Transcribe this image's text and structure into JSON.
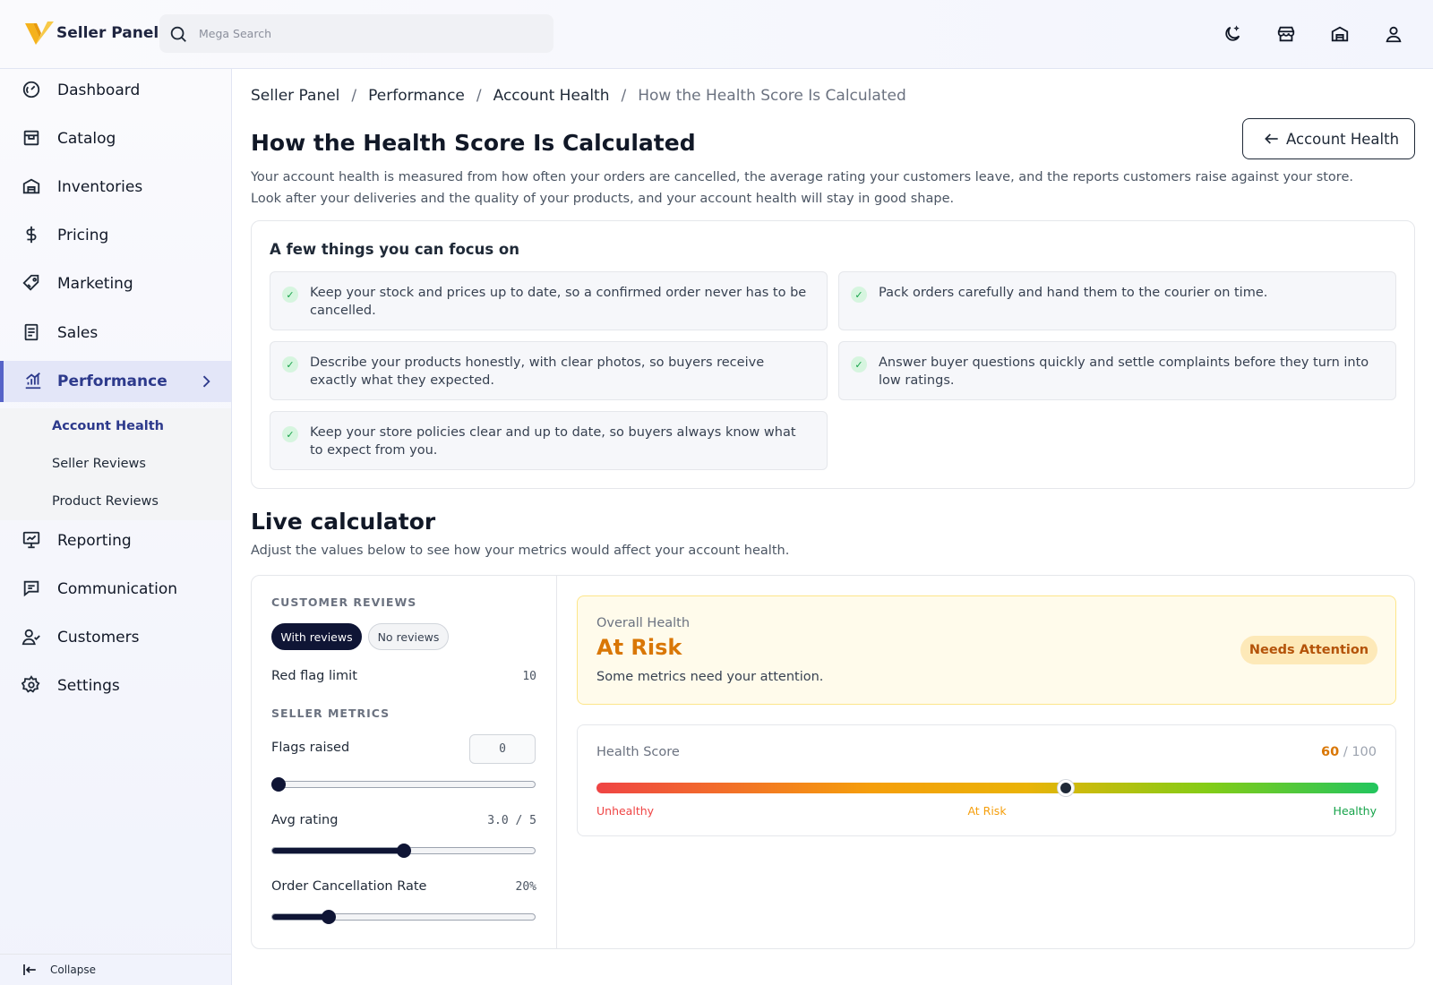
{
  "header": {
    "brand": "Seller Panel",
    "search_placeholder": "Mega Search",
    "icons": [
      "moon-icon",
      "store-icon",
      "warehouse-icon",
      "user-icon"
    ]
  },
  "sidebar": {
    "items": [
      {
        "label": "Dashboard",
        "icon": "gauge-icon"
      },
      {
        "label": "Catalog",
        "icon": "catalog-icon"
      },
      {
        "label": "Inventories",
        "icon": "warehouse-icon"
      },
      {
        "label": "Pricing",
        "icon": "dollar-icon"
      },
      {
        "label": "Marketing",
        "icon": "tag-icon"
      },
      {
        "label": "Sales",
        "icon": "receipt-icon"
      },
      {
        "label": "Performance",
        "icon": "bar-chart-icon"
      },
      {
        "label": "Reporting",
        "icon": "presentation-icon"
      },
      {
        "label": "Communication",
        "icon": "message-icon"
      },
      {
        "label": "Customers",
        "icon": "users-icon"
      },
      {
        "label": "Settings",
        "icon": "gear-icon"
      }
    ],
    "subitems": [
      "Account Health",
      "Seller Reviews",
      "Product Reviews"
    ],
    "collapse_label": "Collapse"
  },
  "breadcrumb": [
    "Seller Panel",
    "Performance",
    "Account Health",
    "How the Health Score Is Calculated"
  ],
  "page": {
    "title": "How the Health Score Is Calculated",
    "back_label": "Account Health",
    "intro_1": "Your account health is measured from how often your orders are cancelled, the average rating your customers leave, and the reports customers raise against your store.",
    "intro_2": "Look after your deliveries and the quality of your products, and your account health will stay in good shape."
  },
  "tips": {
    "title": "A few things you can focus on",
    "items": [
      "Keep your stock and prices up to date, so a confirmed order never has to be cancelled.",
      "Pack orders carefully and hand them to the courier on time.",
      "Describe your products honestly, with clear photos, so buyers receive exactly what they expected.",
      "Answer buyer questions quickly and settle complaints before they turn into low ratings.",
      "Keep your store policies clear and up to date, so buyers always know what to expect from you."
    ]
  },
  "calculator": {
    "title": "Live calculator",
    "subtitle": "Adjust the values below to see how your metrics would affect your account health.",
    "customer_reviews_label": "CUSTOMER REVIEWS",
    "toggle_on": "With reviews",
    "toggle_off": "No reviews",
    "red_flag_label": "Red flag limit",
    "red_flag_value": "10",
    "seller_metrics_label": "SELLER METRICS",
    "flags_label": "Flags raised",
    "flags_value": "0",
    "flags_level": 0,
    "rating_label": "Avg rating",
    "rating_value": "3.0 / 5",
    "rating_level": 0.5,
    "cancel_label": "Order Cancellation Rate",
    "cancel_value": "20%",
    "cancel_level": 0.2
  },
  "overall": {
    "label": "Overall Health",
    "value": "At Risk",
    "desc": "Some metrics need your attention.",
    "badge": "Needs Attention",
    "accent": "#d97706"
  },
  "score": {
    "label": "Health Score",
    "value": "60",
    "max": "/ 100",
    "score_level": 0.6,
    "zones": [
      "Unhealthy",
      "At Risk",
      "Healthy"
    ],
    "zone_colors": [
      "#ef4444",
      "#f59e0b",
      "#16a34a"
    ]
  }
}
